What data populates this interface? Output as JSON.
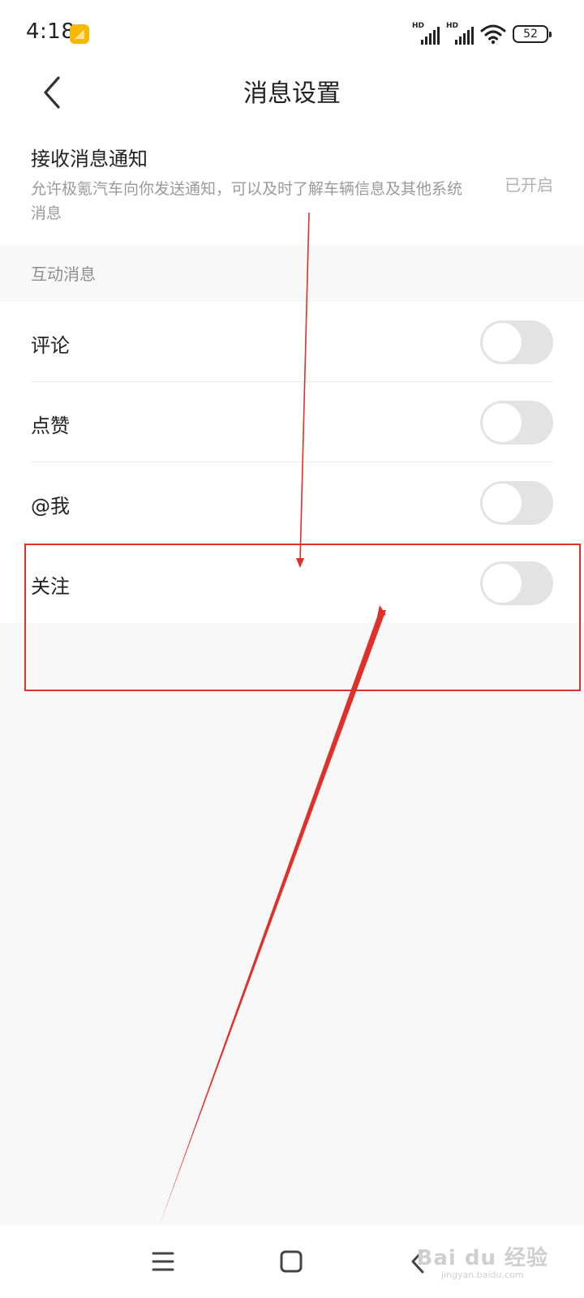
{
  "status_bar": {
    "time": "4:18",
    "sim1_label": "HD",
    "sim2_label": "HD",
    "battery": "52"
  },
  "header": {
    "title": "消息设置"
  },
  "notify": {
    "title": "接收消息通知",
    "description": "允许极氪汽车向你发送通知，可以及时了解车辆信息及其他系统消息",
    "status": "已开启"
  },
  "interaction": {
    "group_label": "互动消息",
    "items": [
      {
        "label": "评论",
        "enabled": false
      },
      {
        "label": "点赞",
        "enabled": false
      },
      {
        "label": "@我",
        "enabled": false
      },
      {
        "label": "关注",
        "enabled": false
      }
    ]
  },
  "annotation": {
    "color": "#e0302a"
  },
  "nav": {
    "menu_icon": "menu-icon",
    "home_icon": "home-square-icon",
    "back_icon": "back-chevron-icon"
  },
  "watermark": {
    "main": "Bai du 经验",
    "sub": "jingyan.baidu.com"
  }
}
